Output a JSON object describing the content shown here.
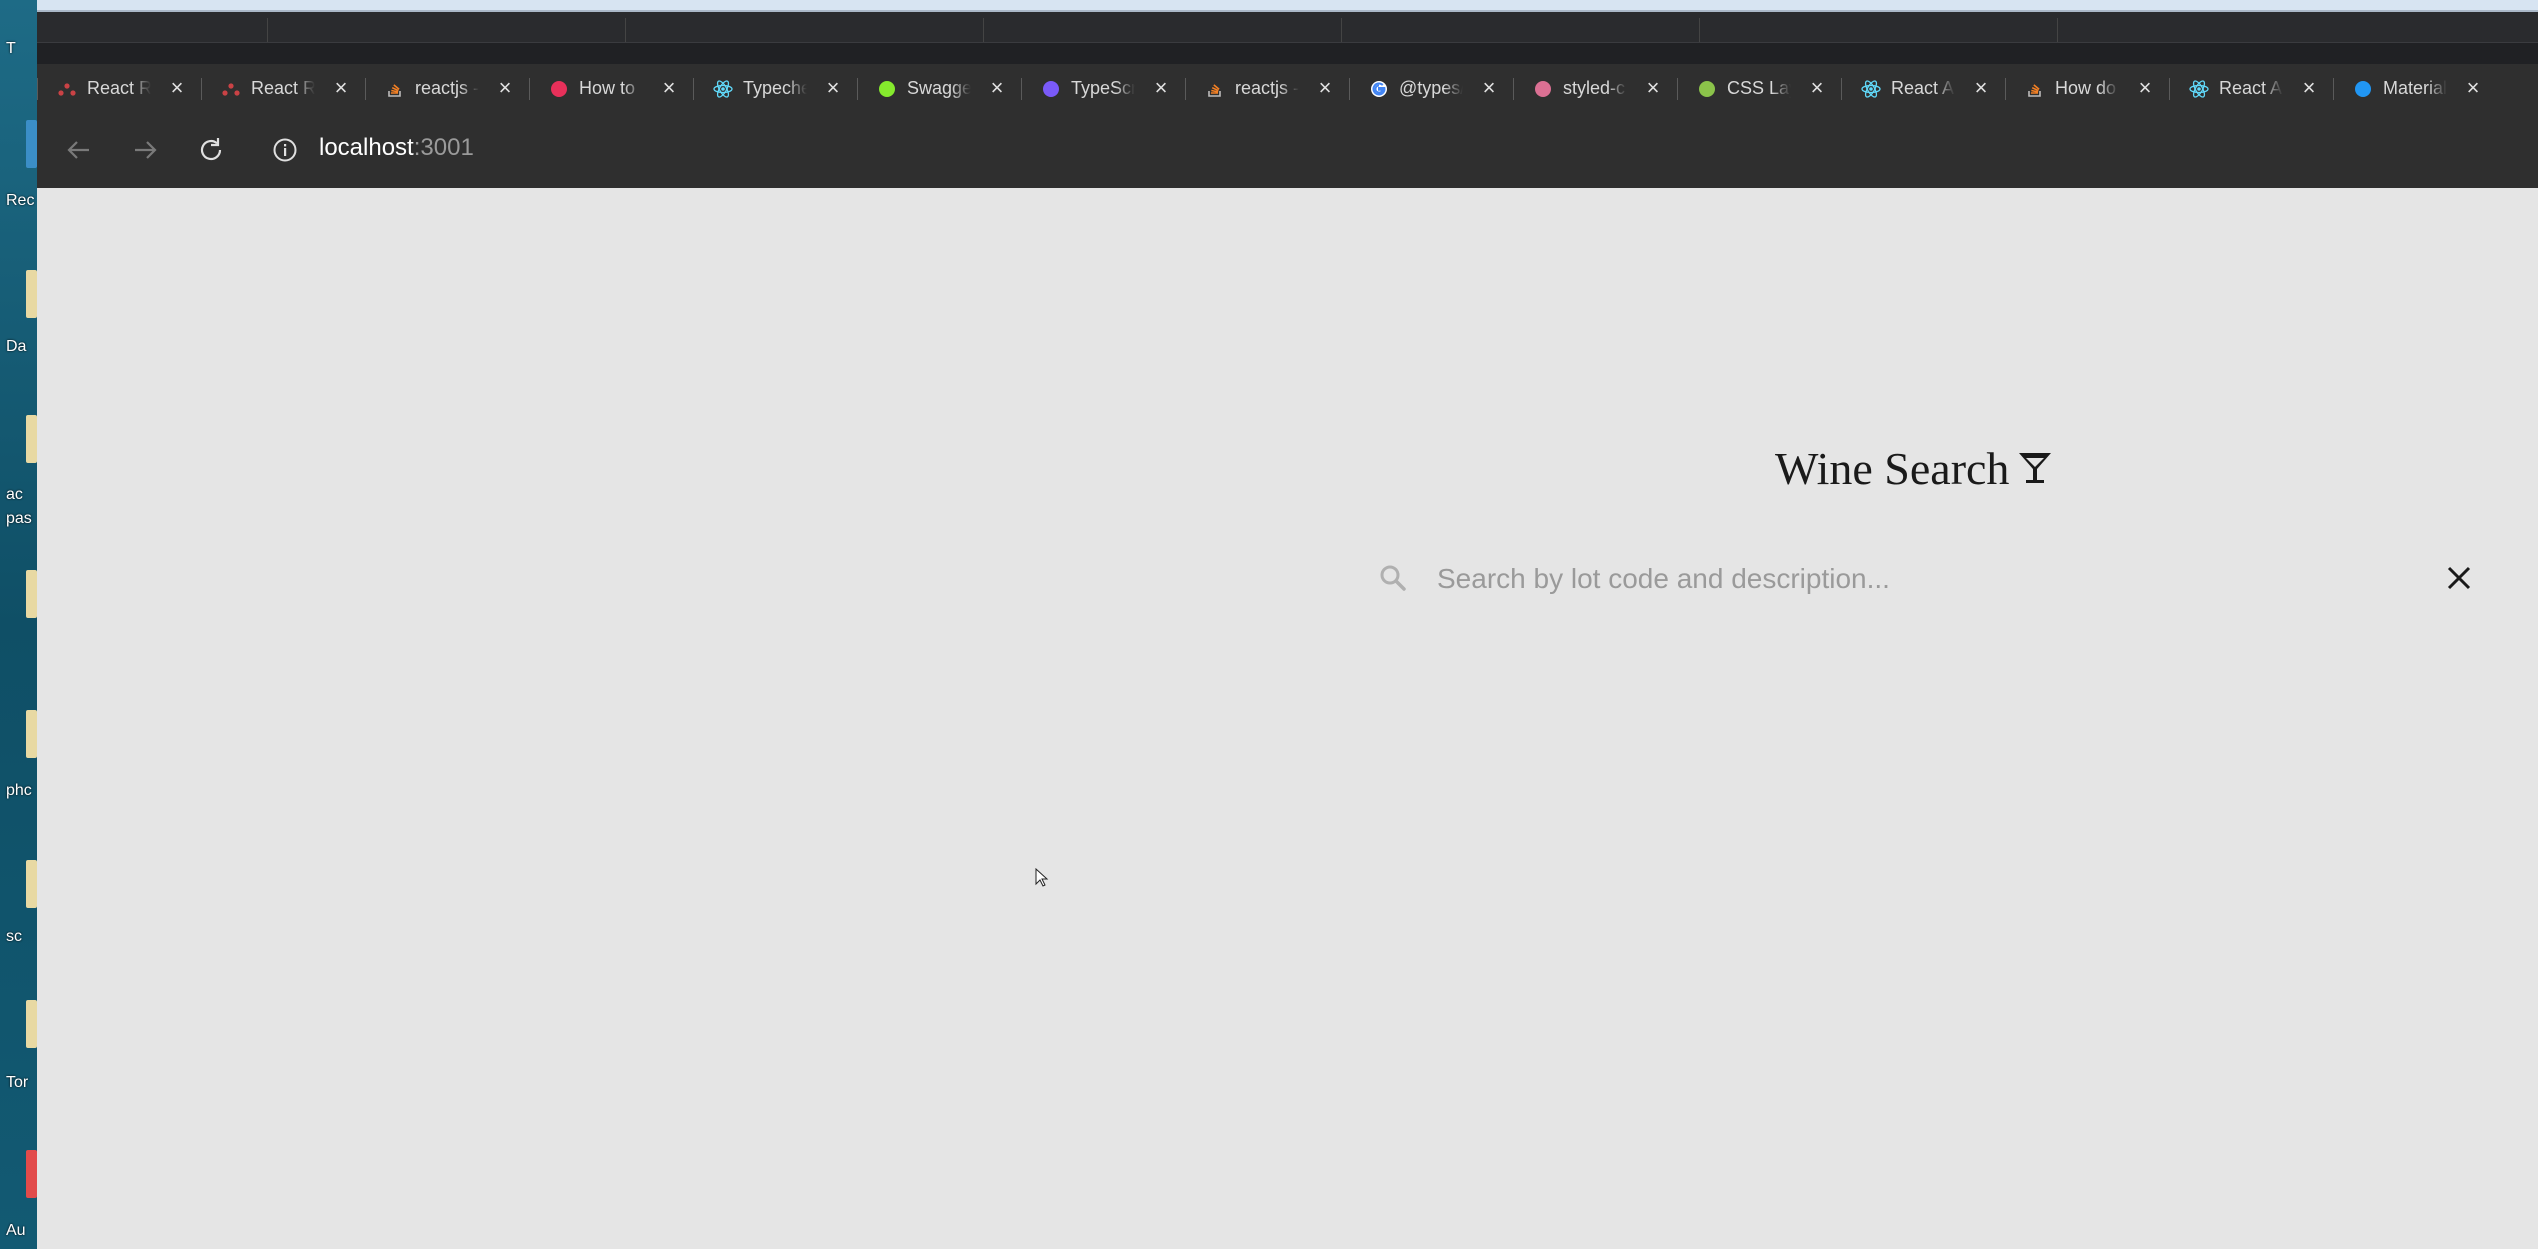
{
  "desktop": {
    "labels": [
      "T",
      "Rec",
      "Da",
      "ac",
      "pas",
      "phc",
      "sc",
      "Tor",
      "Au"
    ]
  },
  "tabs": [
    {
      "title": "React Ro",
      "icon": "react-router-icon"
    },
    {
      "title": "React Ro",
      "icon": "react-router-icon"
    },
    {
      "title": "reactjs -",
      "icon": "stackoverflow-icon"
    },
    {
      "title": "How to",
      "icon": "video-icon"
    },
    {
      "title": "Typechec",
      "icon": "react-icon"
    },
    {
      "title": "Swagger",
      "icon": "swagger-icon"
    },
    {
      "title": "TypeScri",
      "icon": "typescript-icon"
    },
    {
      "title": "reactjs -",
      "icon": "stackoverflow-icon"
    },
    {
      "title": "@types/",
      "icon": "google-icon"
    },
    {
      "title": "styled-c",
      "icon": "styled-components-icon"
    },
    {
      "title": "CSS Lay",
      "icon": "css-icon"
    },
    {
      "title": "React Ap",
      "icon": "react-icon"
    },
    {
      "title": "How do",
      "icon": "stackoverflow-icon"
    },
    {
      "title": "React Ap",
      "icon": "react-icon"
    },
    {
      "title": "Material",
      "icon": "material-icon"
    }
  ],
  "toolbar": {
    "url_host": "localhost",
    "url_port": ":3001"
  },
  "page": {
    "title": "Wine Search",
    "title_icon": "cocktail-icon",
    "search_placeholder": "Search by lot code and description...",
    "search_value": ""
  },
  "colors": {
    "page_background": "#e5e5e5",
    "browser_chrome": "#2f2f2f",
    "title_text": "#1a1a1a",
    "placeholder": "#9a9a9a"
  }
}
